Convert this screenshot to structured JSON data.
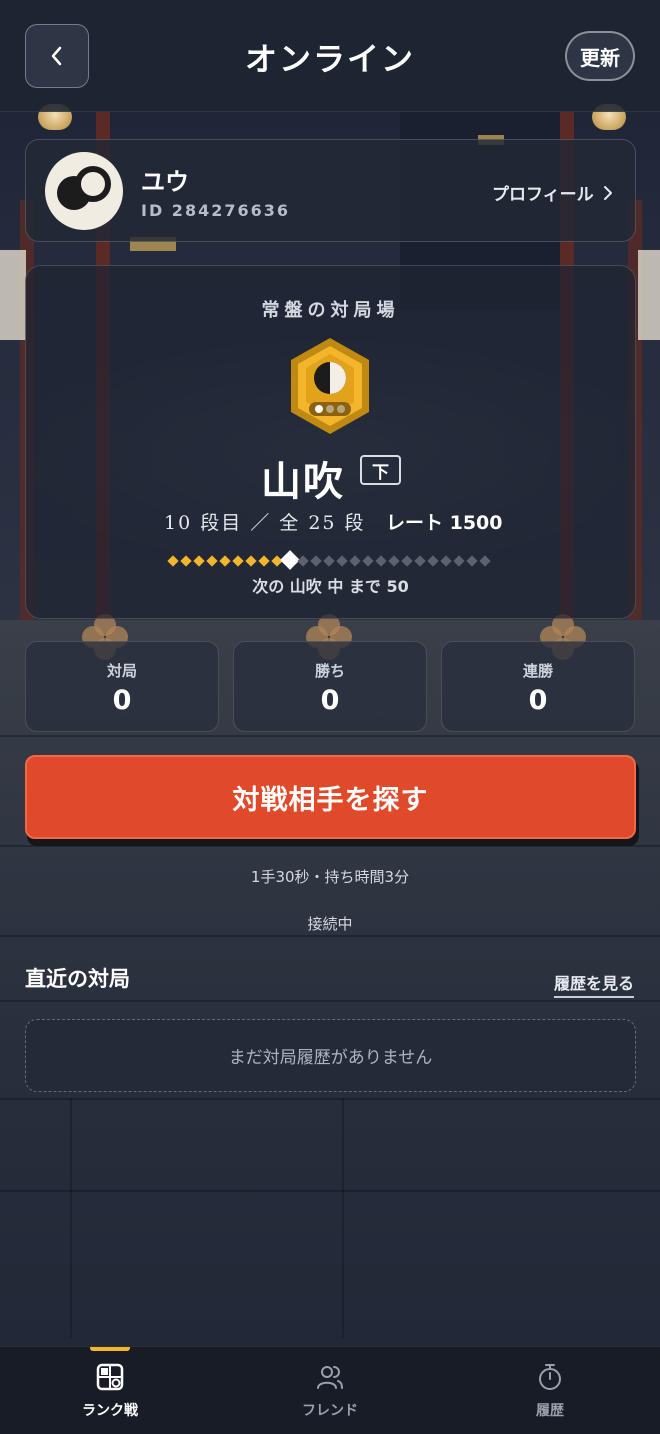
{
  "header": {
    "title": "オンライン",
    "back_icon": "chevron-left-icon",
    "refresh_label": "更新"
  },
  "profile": {
    "name": "ユウ",
    "id_text": "ID 284276636",
    "link_label": "プロフィール",
    "link_icon": "chevron-right-icon"
  },
  "rank": {
    "venue": "常盤の対局場",
    "rank_name": "山吹",
    "tier": "下",
    "stage_text": "10 段目 ／ 全 25 段",
    "rate_text": "レート 1500",
    "progress": {
      "current_stage": 10,
      "total_stages": 25
    },
    "next_text": "次の 山吹 中 まで 50",
    "badge_color": "#f2b52b"
  },
  "stats": [
    {
      "label": "対局",
      "value": "0"
    },
    {
      "label": "勝ち",
      "value": "0"
    },
    {
      "label": "連勝",
      "value": "0"
    }
  ],
  "cta": {
    "label": "対戦相手を探す",
    "color": "#e04a2a"
  },
  "time_info": "1手30秒・持ち時間3分",
  "status": "接続中",
  "recent": {
    "title": "直近の対局",
    "link_label": "履歴を見る",
    "empty_text": "まだ対局履歴がありません"
  },
  "nav": {
    "items": [
      {
        "label": "ランク戦",
        "icon": "board-icon",
        "active": true
      },
      {
        "label": "フレンド",
        "icon": "friends-icon",
        "active": false
      },
      {
        "label": "履歴",
        "icon": "stopwatch-icon",
        "active": false
      }
    ],
    "accent": "#f2b52b"
  }
}
